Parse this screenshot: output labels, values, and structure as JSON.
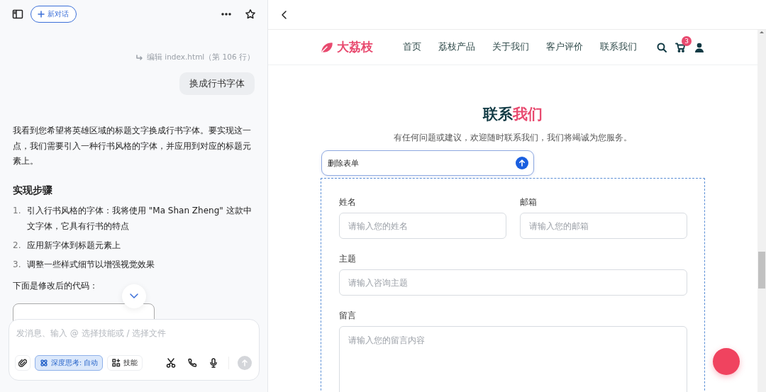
{
  "chat": {
    "new_chat": "新对话",
    "edit_note": "编辑 index.html（第 106 行）",
    "user_message": "换成行书字体",
    "reply": {
      "paragraph": "我看到您希望将英雄区域的标题文字换成行书字体。要实现这一点，我们需要引入一种行书风格的字体，并应用到对应的标题元素上。",
      "heading": "实现步骤",
      "steps": [
        {
          "number": "1.",
          "text": "引入行书风格的字体：我将使用 \"Ma Shan Zheng\" 这款中文字体，它具有行书的特点"
        },
        {
          "number": "2.",
          "text": "应用新字体到标题元素上"
        },
        {
          "number": "3.",
          "text": "调整一些样式细节以增强视觉效果"
        }
      ],
      "code_intro": "下面是修改后的代码："
    },
    "composer": {
      "placeholder": "发消息、输入 @ 选择技能或 / 选择文件",
      "deep_think": {
        "label": "深度思考: 自动",
        "selected": true
      },
      "skills": "技能"
    }
  },
  "preview": {
    "brand": "大荔枝",
    "nav": [
      "首页",
      "荔枝产品",
      "关于我们",
      "客户评价",
      "联系我们"
    ],
    "cart_count": "3",
    "title_lead": "联系",
    "title_accent": "我们",
    "subtitle": "有任何问题或建议，欢迎随时联系我们，我们将竭诚为您服务。",
    "edit_box": {
      "value": "删除表单"
    },
    "form": {
      "rows": [
        [
          {
            "label": "姓名",
            "placeholder": "请输入您的姓名",
            "kind": "input"
          },
          {
            "label": "邮箱",
            "placeholder": "请输入您的邮箱",
            "kind": "input"
          }
        ],
        [
          {
            "label": "主题",
            "placeholder": "请输入咨询主题",
            "kind": "input"
          }
        ],
        [
          {
            "label": "留言",
            "placeholder": "请输入您的留言内容",
            "kind": "textarea"
          }
        ]
      ]
    }
  }
}
